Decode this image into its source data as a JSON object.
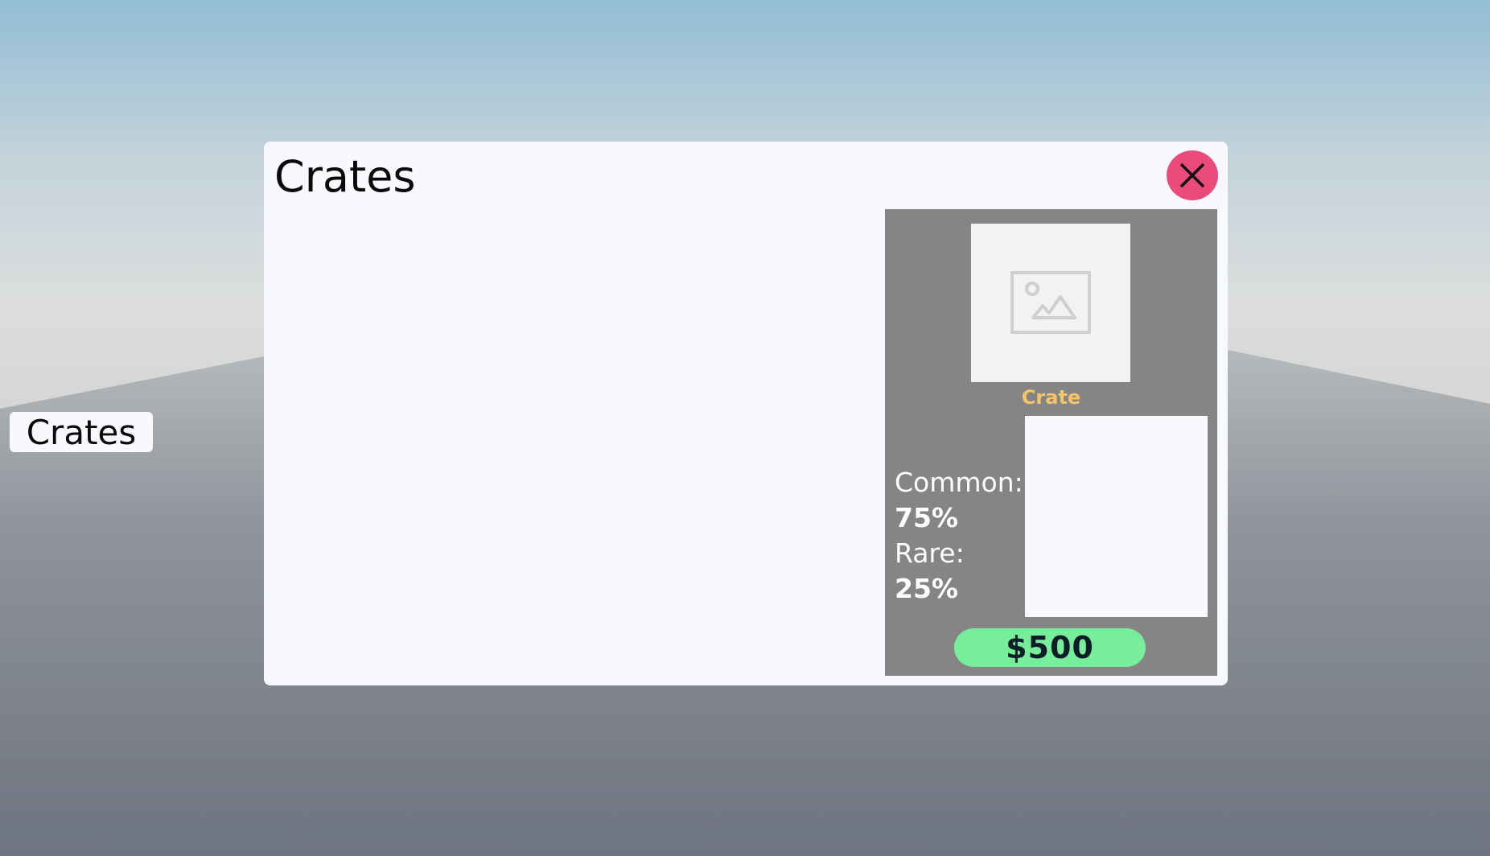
{
  "hud": {
    "open_crates_label": "Crates"
  },
  "modal": {
    "title": "Crates",
    "close_label": "X",
    "crate": {
      "name": "Crate",
      "image_icon": "image-placeholder-icon",
      "odds": [
        {
          "label": "Common:",
          "value": "75%"
        },
        {
          "label": "Rare:",
          "value": "25%"
        }
      ],
      "price": "$500"
    }
  },
  "colors": {
    "close": "#ea4b7c",
    "buy": "#77ee9a",
    "panel": "#858585",
    "crate_name": "#f2c46e"
  }
}
